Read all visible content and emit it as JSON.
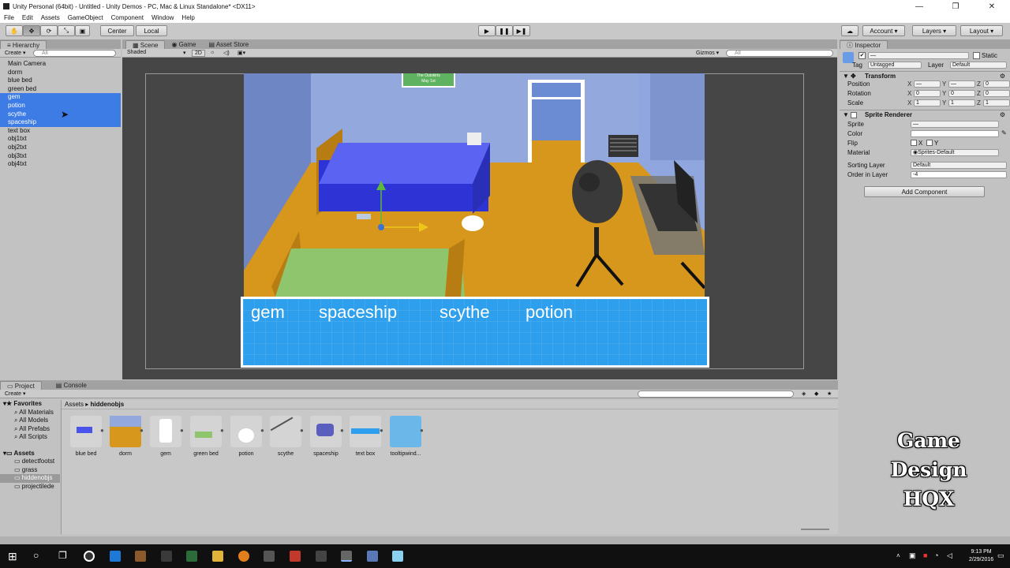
{
  "window": {
    "title": "Unity Personal (64bit) - Untitled - Unity Demos - PC, Mac & Linux Standalone* <DX11>",
    "minimize": "—",
    "maximize": "❐",
    "close": "✕"
  },
  "menu": [
    "File",
    "Edit",
    "Assets",
    "GameObject",
    "Component",
    "Window",
    "Help"
  ],
  "toolbar": {
    "center": "Center",
    "local": "Local",
    "account": "Account",
    "layers": "Layers",
    "layout": "Layout"
  },
  "hierarchy": {
    "tab": "Hierarchy",
    "create": "Create",
    "search_placeholder": "All",
    "items": [
      {
        "label": "Main Camera",
        "selected": false
      },
      {
        "label": "dorm",
        "selected": false
      },
      {
        "label": "blue bed",
        "selected": false
      },
      {
        "label": "green bed",
        "selected": false
      },
      {
        "label": "gem",
        "selected": true
      },
      {
        "label": "potion",
        "selected": true
      },
      {
        "label": "scythe",
        "selected": true
      },
      {
        "label": "spaceship",
        "selected": true
      },
      {
        "label": "text box",
        "selected": false
      },
      {
        "label": "obj1txt",
        "selected": false
      },
      {
        "label": "obj2txt",
        "selected": false
      },
      {
        "label": "obj3txt",
        "selected": false
      },
      {
        "label": "obj4txt",
        "selected": false
      }
    ]
  },
  "scene": {
    "tabs": [
      "Scene",
      "Game",
      "Asset Store"
    ],
    "shading": "Shaded",
    "mode2d": "2D",
    "gizmos": "Gizmos",
    "search_placeholder": "All",
    "sign_line1": "The Outskirts",
    "sign_line2": "May 1st",
    "textbox_words": [
      "gem",
      "spaceship",
      "scythe",
      "potion"
    ]
  },
  "inspector": {
    "tab": "Inspector",
    "name_value": "—",
    "static_label": "Static",
    "tag_label": "Tag",
    "tag_value": "Untagged",
    "layer_label": "Layer",
    "layer_value": "Default",
    "transform": {
      "title": "Transform",
      "rows": [
        {
          "label": "Position",
          "x": "—",
          "y": "—",
          "z": "0"
        },
        {
          "label": "Rotation",
          "x": "0",
          "y": "0",
          "z": "0"
        },
        {
          "label": "Scale",
          "x": "1",
          "y": "1",
          "z": "1"
        }
      ]
    },
    "sprite_renderer": {
      "title": "Sprite Renderer",
      "sprite_label": "Sprite",
      "sprite_value": "—",
      "color_label": "Color",
      "flip_label": "Flip",
      "flip_x": "X",
      "flip_y": "Y",
      "material_label": "Material",
      "material_value": "Sprites-Default",
      "sorting_label": "Sorting Layer",
      "sorting_value": "Default",
      "order_label": "Order in Layer",
      "order_value": "-4"
    },
    "add_component": "Add Component"
  },
  "project": {
    "tabs": [
      "Project",
      "Console"
    ],
    "create": "Create",
    "breadcrumb_root": "Assets",
    "breadcrumb_sep": "▸",
    "breadcrumb_current": "hiddenobjs",
    "favorites_label": "Favorites",
    "favorites": [
      "All Materials",
      "All Models",
      "All Prefabs",
      "All Scripts"
    ],
    "assets_label": "Assets",
    "folders": [
      "detectfootst",
      "grass",
      "hiddenobjs",
      "projectilede"
    ],
    "items": [
      "blue bed",
      "dorm",
      "gem",
      "green bed",
      "potion",
      "scythe",
      "spaceship",
      "text box",
      "tooltipwind..."
    ]
  },
  "watermark": [
    "Game",
    "Design",
    "HQX"
  ],
  "taskbar": {
    "time": "9:13 PM",
    "date": "2/29/2016"
  },
  "colors": {
    "selection": "#3e7ce5",
    "floor": "#d7961c",
    "bed_blue": "#4a53ea",
    "bed_green": "#8fc66d",
    "textbox": "#2e9fec"
  }
}
